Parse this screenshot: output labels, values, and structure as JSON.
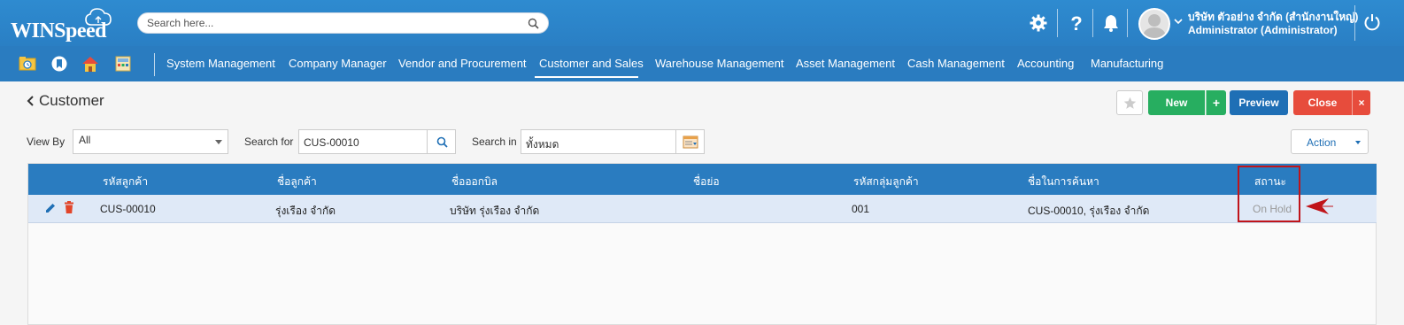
{
  "header": {
    "logo_text": "WINSpeed",
    "search_placeholder": "Search here...",
    "user_company": "บริษัท ตัวอย่าง จำกัด (สำนักงานใหญ่)",
    "user_role": "Administrator (Administrator)"
  },
  "nav": {
    "items": [
      "System Management",
      "Company Manager",
      "Vendor and Procurement",
      "Customer and Sales",
      "Warehouse Management",
      "Asset Management",
      "Cash Management",
      "Accounting",
      "Manufacturing"
    ],
    "active": "Customer and Sales"
  },
  "page": {
    "title": "Customer",
    "buttons": {
      "new": "New",
      "new_plus": "+",
      "preview": "Preview",
      "close": "Close",
      "close_x": "×",
      "action": "Action"
    }
  },
  "filters": {
    "view_by_label": "View By",
    "view_by_value": "All",
    "search_for_label": "Search for",
    "search_for_value": "CUS-00010",
    "search_in_label": "Search in",
    "search_in_value": "ทั้งหมด"
  },
  "grid": {
    "columns": [
      "รหัสลูกค้า",
      "ชื่อลูกค้า",
      "ชื่อออกบิล",
      "ชื่อย่อ",
      "รหัสกลุ่มลูกค้า",
      "ชื่อในการค้นหา",
      "สถานะ"
    ],
    "rows": [
      {
        "code": "CUS-00010",
        "name": "รุ่งเรือง จำกัด",
        "bill_name": "บริษัท รุ่งเรือง จำกัด",
        "short_name": "",
        "group_code": "001",
        "search_name": "CUS-00010, รุ่งเรือง จำกัด",
        "status": "On Hold"
      }
    ]
  },
  "colors": {
    "header_blue": "#2e8bd0",
    "nav_blue": "#2a7cc0",
    "green": "#27ae60",
    "red": "#e74c3c",
    "highlight_red": "#c0141a"
  }
}
